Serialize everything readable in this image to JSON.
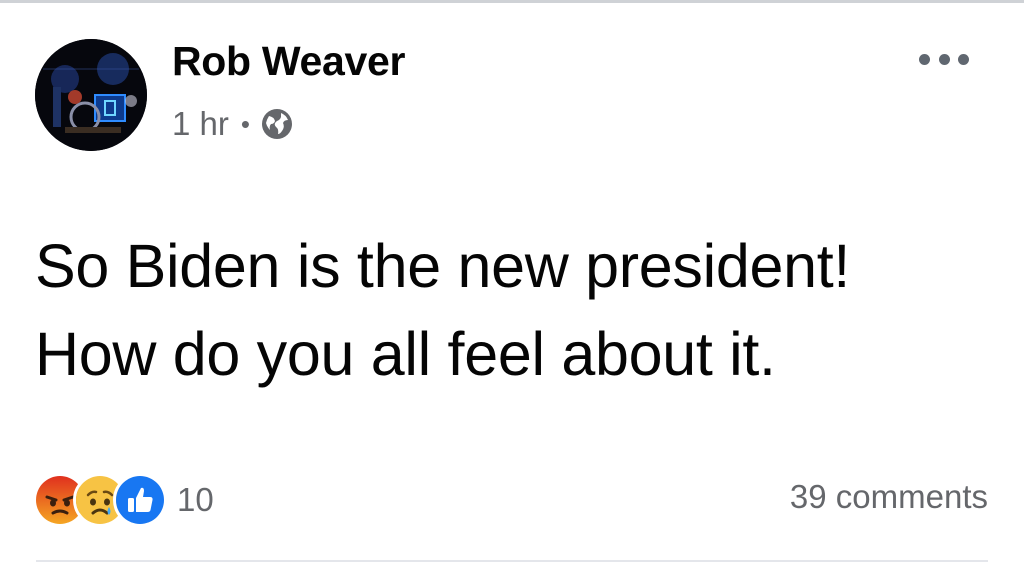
{
  "post": {
    "author_name": "Rob Weaver",
    "timestamp": "1 hr",
    "separator": "•",
    "audience_icon": "globe-icon",
    "more_icon": "more-options-icon",
    "message_lines": [
      "So Biden is the new president!",
      "How do you all feel about it."
    ],
    "reactions": {
      "types": [
        "angry",
        "sad",
        "like"
      ],
      "count": "10"
    },
    "comments_label": "39 comments"
  },
  "colors": {
    "text_primary": "#050505",
    "text_secondary": "#65676b",
    "like_blue": "#1877f2",
    "angry_orange": "#e9710f",
    "sad_yellow": "#f7b125"
  }
}
